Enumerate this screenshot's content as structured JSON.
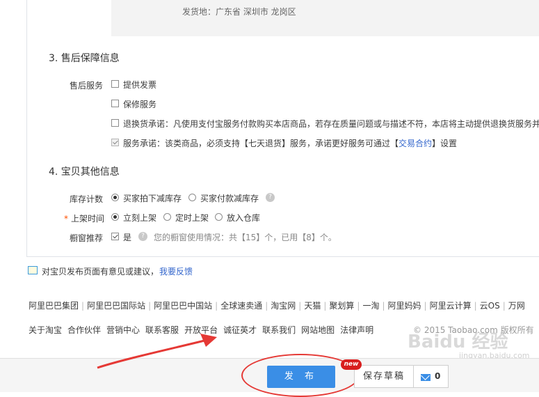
{
  "shipping": {
    "text": "发货地：广东省 深圳市 龙岗区"
  },
  "after_sales": {
    "title": "3. 售后保障信息",
    "label": "售后服务",
    "options": [
      {
        "text": "提供发票",
        "checked": false
      },
      {
        "text": "保修服务",
        "checked": false
      },
      {
        "text": "退换货承诺：凡使用支付宝服务付款购买本店商品，若存在质量问题或与描述不符，本店将主动提供退换货服务并",
        "checked": false
      },
      {
        "prefix": "服务承诺：该类商品，必须支持【七天退货】服务，承诺更好服务可通过【",
        "link": "交易合约",
        "suffix": "】设置",
        "checked": true
      }
    ]
  },
  "other_info": {
    "title": "4. 宝贝其他信息",
    "stock_label": "库存计数",
    "stock_options": [
      "买家拍下减库存",
      "买家付款减库存"
    ],
    "listing_label": "上架时间",
    "listing_required": "*",
    "listing_options": [
      "立刻上架",
      "定时上架",
      "放入仓库"
    ],
    "window_label": "橱窗推荐",
    "window_value": "是",
    "window_hint": "您的橱窗使用情况：共【15】个，已用【8】个。"
  },
  "feedback": {
    "text": "对宝贝发布页面有意见或建议，",
    "link": "我要反馈"
  },
  "footer_links_1": [
    "阿里巴巴集团",
    "阿里巴巴国际站",
    "阿里巴巴中国站",
    "全球速卖通",
    "淘宝网",
    "天猫",
    "聚划算",
    "一淘",
    "阿里妈妈",
    "阿里云计算",
    "云OS",
    "万网"
  ],
  "footer_links_2": [
    "关于淘宝",
    "合作伙伴",
    "营销中心",
    "联系客服",
    "开放平台",
    "诚征英才",
    "联系我们",
    "网站地图",
    "法律声明"
  ],
  "copyright": "© 2015 Taobao.com 版权所有",
  "actions": {
    "publish_label": "发 布",
    "new_badge": "new",
    "draft_label": "保存草稿",
    "mail_count": "0"
  },
  "watermark": {
    "text": "Baidu 经验",
    "sub": "jingyan.baidu.com"
  },
  "colors": {
    "accent": "#3a8ee6",
    "annotation_red": "#e53935",
    "badge_red": "#d81e1e"
  }
}
